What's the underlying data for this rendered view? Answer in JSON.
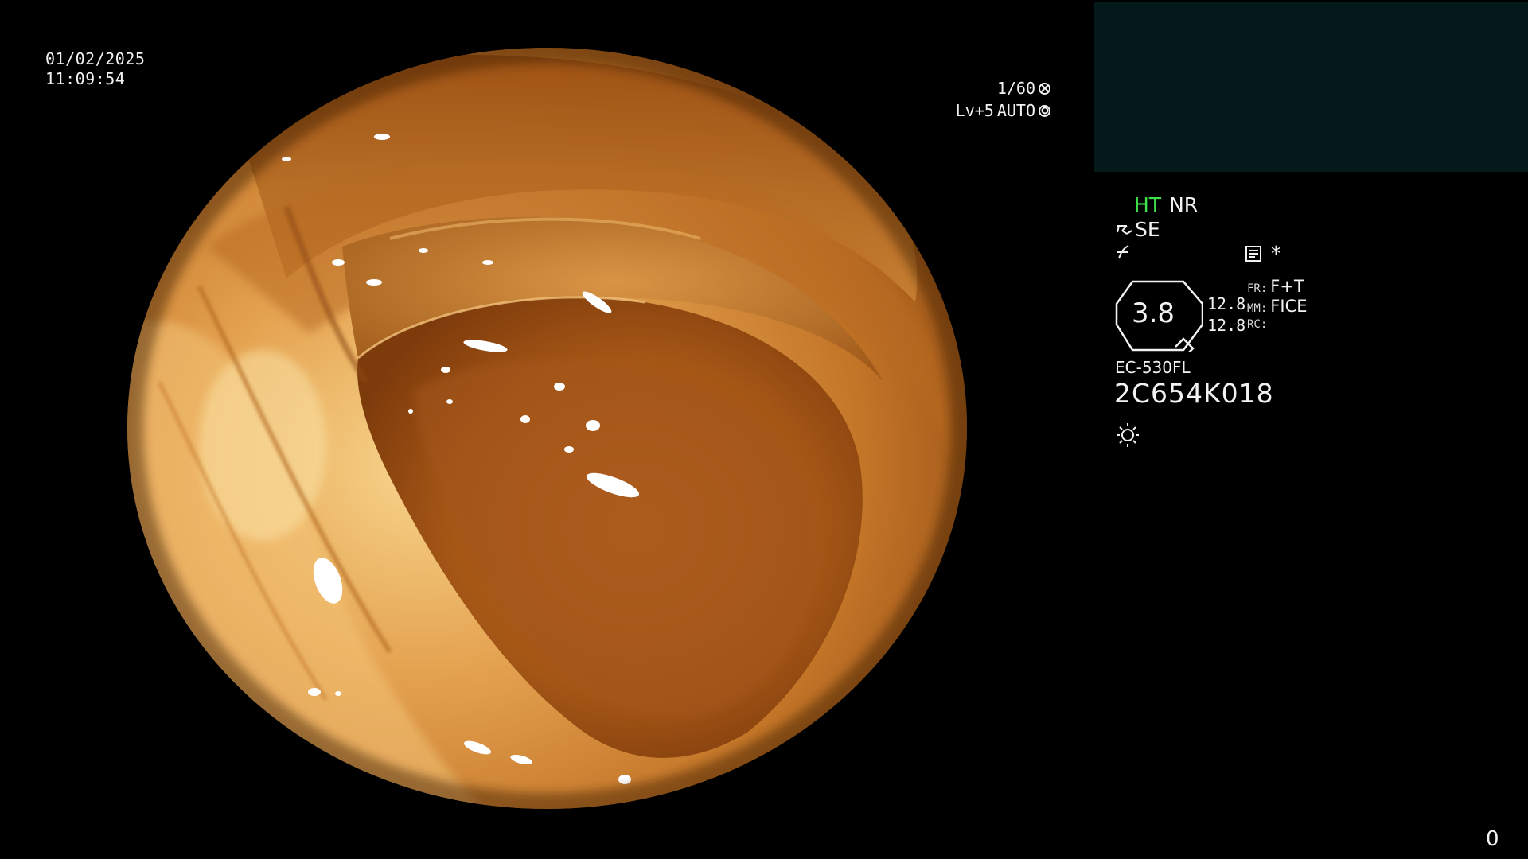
{
  "datetime": {
    "date": "01/02/2025",
    "time": "11:09:54"
  },
  "exposure": {
    "shutter": "1/60",
    "shutter_icon": "aperture-icon",
    "level": "Lv+5",
    "mode": "AUTO",
    "mode_icon": "target-icon"
  },
  "view": {
    "type": "endoscopic-colon-image",
    "colors": {
      "mucosa_light": "#f2c074",
      "mucosa_mid": "#c97a2c",
      "mucosa_dark": "#7a3a0c",
      "lumen": "#a85a1c"
    }
  },
  "thumbnail_panel": {
    "color": "#04191a"
  },
  "status": {
    "ht": "HT",
    "nr": "NR",
    "se": "SE",
    "se_icon": "structure-enhance-icon",
    "filter_icon": "filter-icon",
    "memo_icon": "memo-icon",
    "star": "*",
    "ht_color": "#3fe04a"
  },
  "zoom": {
    "value": "3.8",
    "a": "12.8",
    "b": "12.8"
  },
  "modes": {
    "fr_key": "FR:",
    "fr_value": "F+T",
    "mm_key": "MM:",
    "mm_value": "FICE",
    "rc_key": "RC:",
    "rc_value": ""
  },
  "scope": {
    "model": "EC-530FL",
    "serial": "2C654K018",
    "light_icon": "light-source-icon"
  },
  "frame_counter": "0"
}
